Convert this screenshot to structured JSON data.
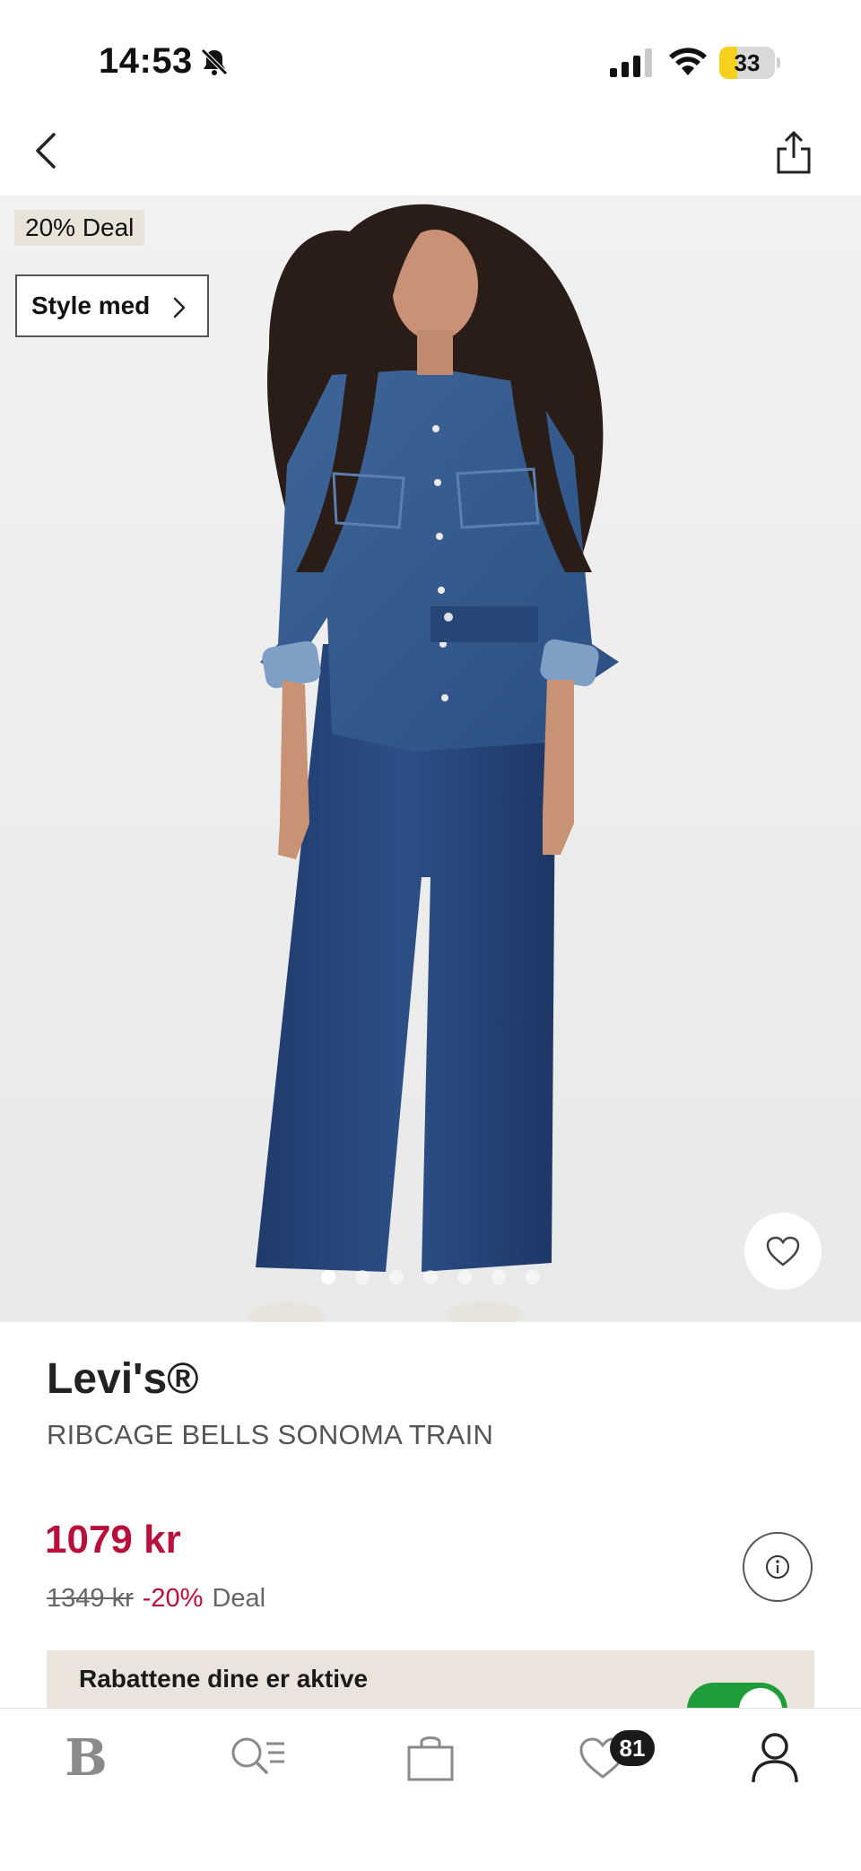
{
  "status_bar": {
    "time": "14:53",
    "battery_level": "33",
    "battery_fraction": 0.33
  },
  "nav": {
    "back_icon": "chevron-left-icon",
    "share_icon": "share-icon"
  },
  "hero": {
    "deal_tag": "20% Deal",
    "style_med_label": "Style med",
    "image_count": 7,
    "active_image_index": 0
  },
  "product": {
    "brand": "Levi's®",
    "name": "RIBCAGE BELLS SONOMA TRAIN",
    "price": "1079 kr",
    "old_price": "1349 kr",
    "discount": "-20%",
    "deal_label": "Deal"
  },
  "discount_banner": {
    "text": "Rabattene dine er aktive",
    "toggle_on": true
  },
  "tab_bar": {
    "home_logo": "B",
    "favorites_badge": "81",
    "colors": {
      "price_red": "#b8103a",
      "toggle_green": "#1f9d3a",
      "battery_yellow": "#f7cf1d"
    }
  }
}
